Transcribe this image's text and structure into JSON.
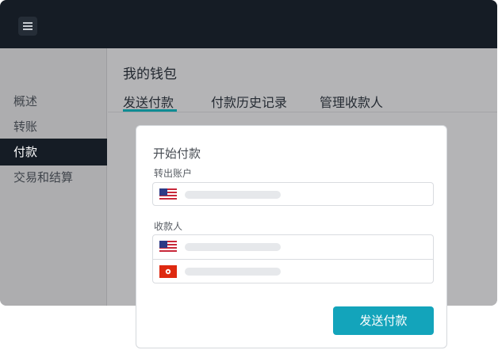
{
  "sidebar": {
    "items": [
      {
        "label": "概述"
      },
      {
        "label": "转账"
      },
      {
        "label": "付款"
      },
      {
        "label": "交易和结算"
      }
    ]
  },
  "main": {
    "title": "我的钱包",
    "tabs": [
      {
        "label": "发送付款"
      },
      {
        "label": "付款历史记录"
      },
      {
        "label": "管理收款人"
      }
    ]
  },
  "modal": {
    "title": "开始付款",
    "from_label": "转出账户",
    "to_label": "收款人",
    "send_label": "发送付款",
    "from_account": {
      "flag": "us-flag-icon"
    },
    "recipients": [
      {
        "flag": "us-flag-icon"
      },
      {
        "flag": "hk-flag-icon"
      }
    ]
  },
  "colors": {
    "topbar": "#151c25",
    "accent": "#13a4bb",
    "tab_underline": "#0f8c93"
  }
}
